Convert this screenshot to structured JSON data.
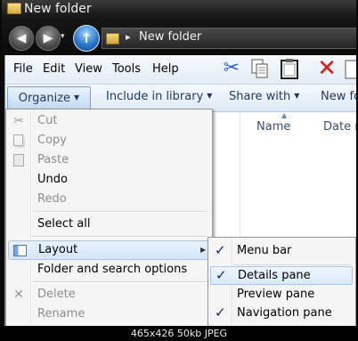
{
  "window": {
    "title": "New folder"
  },
  "address_bar": {
    "path_segment": "New folder",
    "chevron": "▸"
  },
  "nav_buttons": {
    "back": "◀",
    "forward": "▶",
    "up": "↑"
  },
  "menubar": {
    "items": [
      "File",
      "Edit",
      "View",
      "Tools",
      "Help"
    ]
  },
  "toolbar_icons": [
    "cut-icon",
    "copy-icon",
    "paste-icon",
    "delete-icon",
    "properties-icon"
  ],
  "commandbar": {
    "organize": "Organize",
    "include_in_library": "Include in library",
    "share_with": "Share with",
    "new_folder": "New fo"
  },
  "columns": {
    "name": "Name",
    "date": "Date m"
  },
  "organize_menu": {
    "items": [
      {
        "label": "Cut",
        "enabled": false,
        "icon": "scissors-icon"
      },
      {
        "label": "Copy",
        "enabled": false,
        "icon": "copy-icon"
      },
      {
        "label": "Paste",
        "enabled": false,
        "icon": "paste-icon"
      },
      {
        "label": "Undo",
        "enabled": true
      },
      {
        "label": "Redo",
        "enabled": false
      },
      {
        "label": "Select all",
        "enabled": true
      },
      {
        "label": "Layout",
        "enabled": true,
        "icon": "layout-icon",
        "has_submenu": true,
        "highlighted": true
      },
      {
        "label": "Folder and search options",
        "enabled": true
      },
      {
        "label": "Delete",
        "enabled": false,
        "icon": "delete-x-icon"
      },
      {
        "label": "Rename",
        "enabled": false
      }
    ]
  },
  "layout_submenu": {
    "items": [
      {
        "label": "Menu bar",
        "checked": true
      },
      {
        "label": "Details pane",
        "checked": true,
        "highlighted": true
      },
      {
        "label": "Preview pane",
        "checked": false
      },
      {
        "label": "Navigation pane",
        "checked": true
      }
    ],
    "check_glyph": "✓"
  },
  "caption": "465x426  50kb  JPEG"
}
